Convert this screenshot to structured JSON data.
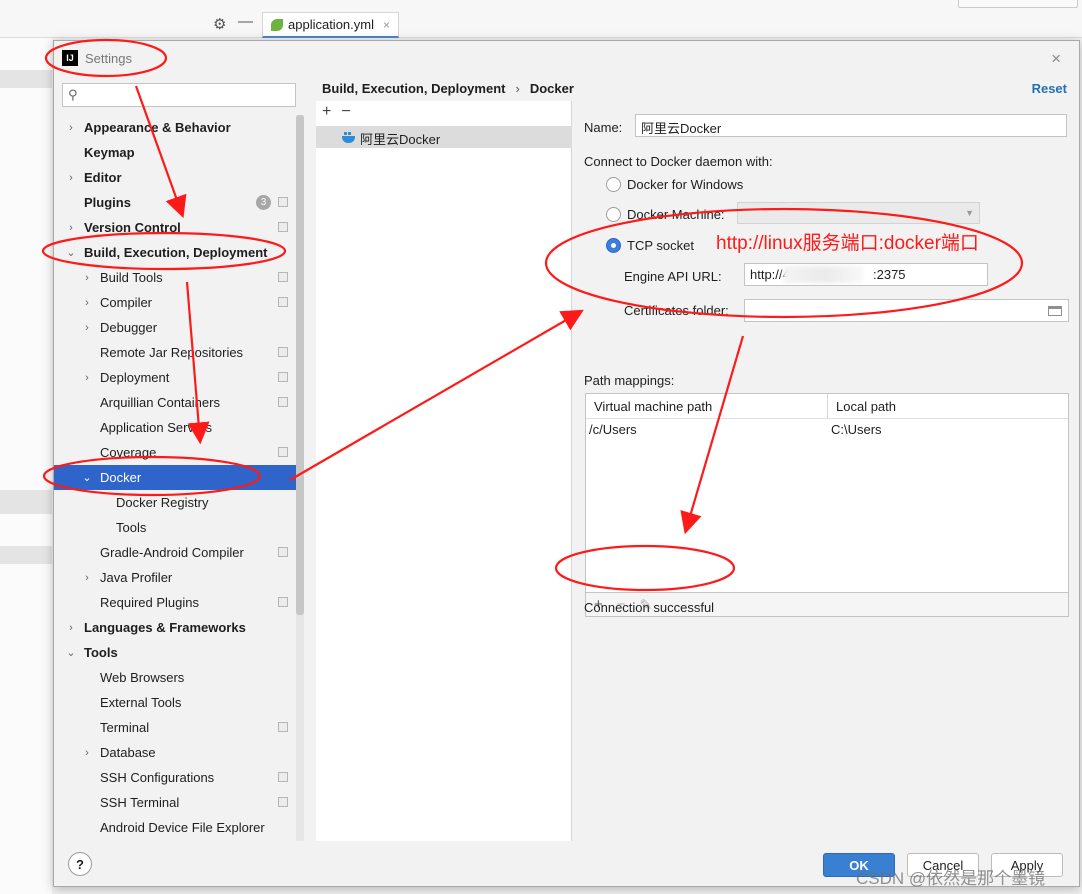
{
  "ide": {
    "editor_tab": "application.yml",
    "tab_close": "×",
    "gear": "⚙",
    "minimize": "—"
  },
  "dialog": {
    "title": "Settings",
    "app_icon_text": "IJ",
    "close": "×",
    "search_placeholder": ""
  },
  "tree": [
    {
      "label": "Appearance & Behavior",
      "bold": true,
      "chevron": "›",
      "level": 0
    },
    {
      "label": "Keymap",
      "bold": true,
      "chevron": "",
      "level": 0
    },
    {
      "label": "Editor",
      "bold": true,
      "chevron": "›",
      "level": 0
    },
    {
      "label": "Plugins",
      "bold": true,
      "chevron": "",
      "level": 0,
      "badge": "3",
      "project": true
    },
    {
      "label": "Version Control",
      "bold": true,
      "chevron": "›",
      "level": 0,
      "project": true
    },
    {
      "label": "Build, Execution, Deployment",
      "bold": true,
      "chevron": "⌄",
      "level": 0
    },
    {
      "label": "Build Tools",
      "bold": false,
      "chevron": "›",
      "level": 1,
      "project": true
    },
    {
      "label": "Compiler",
      "bold": false,
      "chevron": "›",
      "level": 1,
      "project": true
    },
    {
      "label": "Debugger",
      "bold": false,
      "chevron": "›",
      "level": 1
    },
    {
      "label": "Remote Jar Repositories",
      "bold": false,
      "chevron": "",
      "level": 1,
      "project": true
    },
    {
      "label": "Deployment",
      "bold": false,
      "chevron": "›",
      "level": 1,
      "project": true
    },
    {
      "label": "Arquillian Containers",
      "bold": false,
      "chevron": "",
      "level": 1,
      "project": true
    },
    {
      "label": "Application Servers",
      "bold": false,
      "chevron": "",
      "level": 1
    },
    {
      "label": "Coverage",
      "bold": false,
      "chevron": "",
      "level": 1,
      "project": true
    },
    {
      "label": "Docker",
      "bold": false,
      "chevron": "⌄",
      "level": 1,
      "selected": true
    },
    {
      "label": "Docker Registry",
      "bold": false,
      "chevron": "",
      "level": 2
    },
    {
      "label": "Tools",
      "bold": false,
      "chevron": "",
      "level": 2
    },
    {
      "label": "Gradle-Android Compiler",
      "bold": false,
      "chevron": "",
      "level": 1,
      "project": true
    },
    {
      "label": "Java Profiler",
      "bold": false,
      "chevron": "›",
      "level": 1
    },
    {
      "label": "Required Plugins",
      "bold": false,
      "chevron": "",
      "level": 1,
      "project": true
    },
    {
      "label": "Languages & Frameworks",
      "bold": true,
      "chevron": "›",
      "level": 0
    },
    {
      "label": "Tools",
      "bold": true,
      "chevron": "⌄",
      "level": 0
    },
    {
      "label": "Web Browsers",
      "bold": false,
      "chevron": "",
      "level": 1
    },
    {
      "label": "External Tools",
      "bold": false,
      "chevron": "",
      "level": 1
    },
    {
      "label": "Terminal",
      "bold": false,
      "chevron": "",
      "level": 1,
      "project": true
    },
    {
      "label": "Database",
      "bold": false,
      "chevron": "›",
      "level": 1
    },
    {
      "label": "SSH Configurations",
      "bold": false,
      "chevron": "",
      "level": 1,
      "project": true
    },
    {
      "label": "SSH Terminal",
      "bold": false,
      "chevron": "",
      "level": 1,
      "project": true
    },
    {
      "label": "Android Device File Explorer",
      "bold": false,
      "chevron": "",
      "level": 1
    }
  ],
  "header": {
    "crumb_parent": "Build, Execution, Deployment",
    "crumb_sep": "›",
    "crumb_current": "Docker",
    "reset": "Reset"
  },
  "servers": {
    "add": "+",
    "remove": "−",
    "items": [
      "阿里云Docker"
    ]
  },
  "form": {
    "name_label": "Name:",
    "name_value": "阿里云Docker",
    "connect_label": "Connect to Docker daemon with:",
    "option_windows": "Docker for Windows",
    "option_machine": "Docker Machine:",
    "option_tcp": "TCP socket",
    "api_url_label": "Engine API URL:",
    "api_url_prefix": "http://4",
    "api_url_suffix": ":2375",
    "cert_label": "Certificates folder:",
    "cert_value": "",
    "path_mappings_label": "Path mappings:",
    "col_vm": "Virtual machine path",
    "col_local": "Local path",
    "row_vm": "/c/Users",
    "row_local": "C:\\Users",
    "add": "+",
    "remove": "−",
    "edit": "✎",
    "status": "Connection successful"
  },
  "buttons": {
    "help": "?",
    "ok": "OK",
    "cancel": "Cancel",
    "apply": "Apply"
  },
  "annotation": {
    "text": "http://linux服务端口:docker端口",
    "color": "#ff1a1a"
  },
  "watermark": "CSDN @依然是那个墨镜",
  "colors": {
    "selection": "#2f65ca",
    "link": "#2470b3",
    "ok_button": "#3a80d2"
  }
}
